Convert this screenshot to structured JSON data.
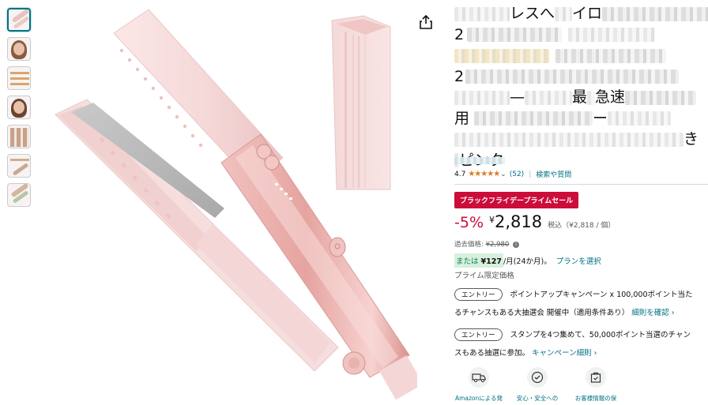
{
  "thumbnails": [
    {
      "name": "thumb-1",
      "active": true
    },
    {
      "name": "thumb-2",
      "active": false
    },
    {
      "name": "thumb-3",
      "active": false
    },
    {
      "name": "thumb-4",
      "active": false
    },
    {
      "name": "thumb-5",
      "active": false
    },
    {
      "name": "thumb-6",
      "active": false
    },
    {
      "name": "thumb-7",
      "active": false
    }
  ],
  "share_icon": "share-icon",
  "title": {
    "line1_visible": "レスへ",
    "line1_visible_b": "イロ",
    "line3_visible": "2",
    "line5_visible_a": "—",
    "line5_visible_b": "最",
    "line5_visible_c": "急",
    "line5_visible_d": "速",
    "line6_visible_a": "用",
    "line6_visible_b": "ー",
    "line7_visible": "き",
    "line8_visible": "ピンク"
  },
  "rating": {
    "value": "4.7",
    "stars": "★★★★★",
    "count": "(52)",
    "separator": "|",
    "link": "検索や質問"
  },
  "deal_badge": "ブラックフライデープライムセール",
  "price": {
    "discount": "-5%",
    "currency": "¥",
    "amount": "2,818",
    "note": "税込（¥2,818 / 個）"
  },
  "past_price": {
    "label": "過去価格:",
    "value": "¥2,980"
  },
  "monthly": {
    "prefix": "または",
    "amount": "¥127",
    "suffix": "/月(24か月)。",
    "link": "プランを選択"
  },
  "prime_note": "プライム限定価格",
  "promos": [
    {
      "entry": "エントリー",
      "line1": "ポイントアップキャンペーン x 100,000ポイント当た",
      "line2": "るチャンスもある大抽選会 開催中（適用条件あり）",
      "link": "細則を確認 ›"
    },
    {
      "entry": "エントリー",
      "line1": "スタンプを4つ集めて、50,000ポイント当選のチャン",
      "line2": "スもある抽選に参加。",
      "link": "キャンペーン細則 ›"
    }
  ],
  "features": [
    {
      "icon": "delivery-truck-icon",
      "label": "Amazonによる発"
    },
    {
      "icon": "safety-badge-icon",
      "label": "安心・安全への"
    },
    {
      "icon": "support-bag-icon",
      "label": "お客様情報の保"
    }
  ],
  "colors": {
    "deal_red": "#cc0c39",
    "link_teal": "#007185",
    "star_orange": "#de7921",
    "product_pink": "#f4d6d6"
  }
}
